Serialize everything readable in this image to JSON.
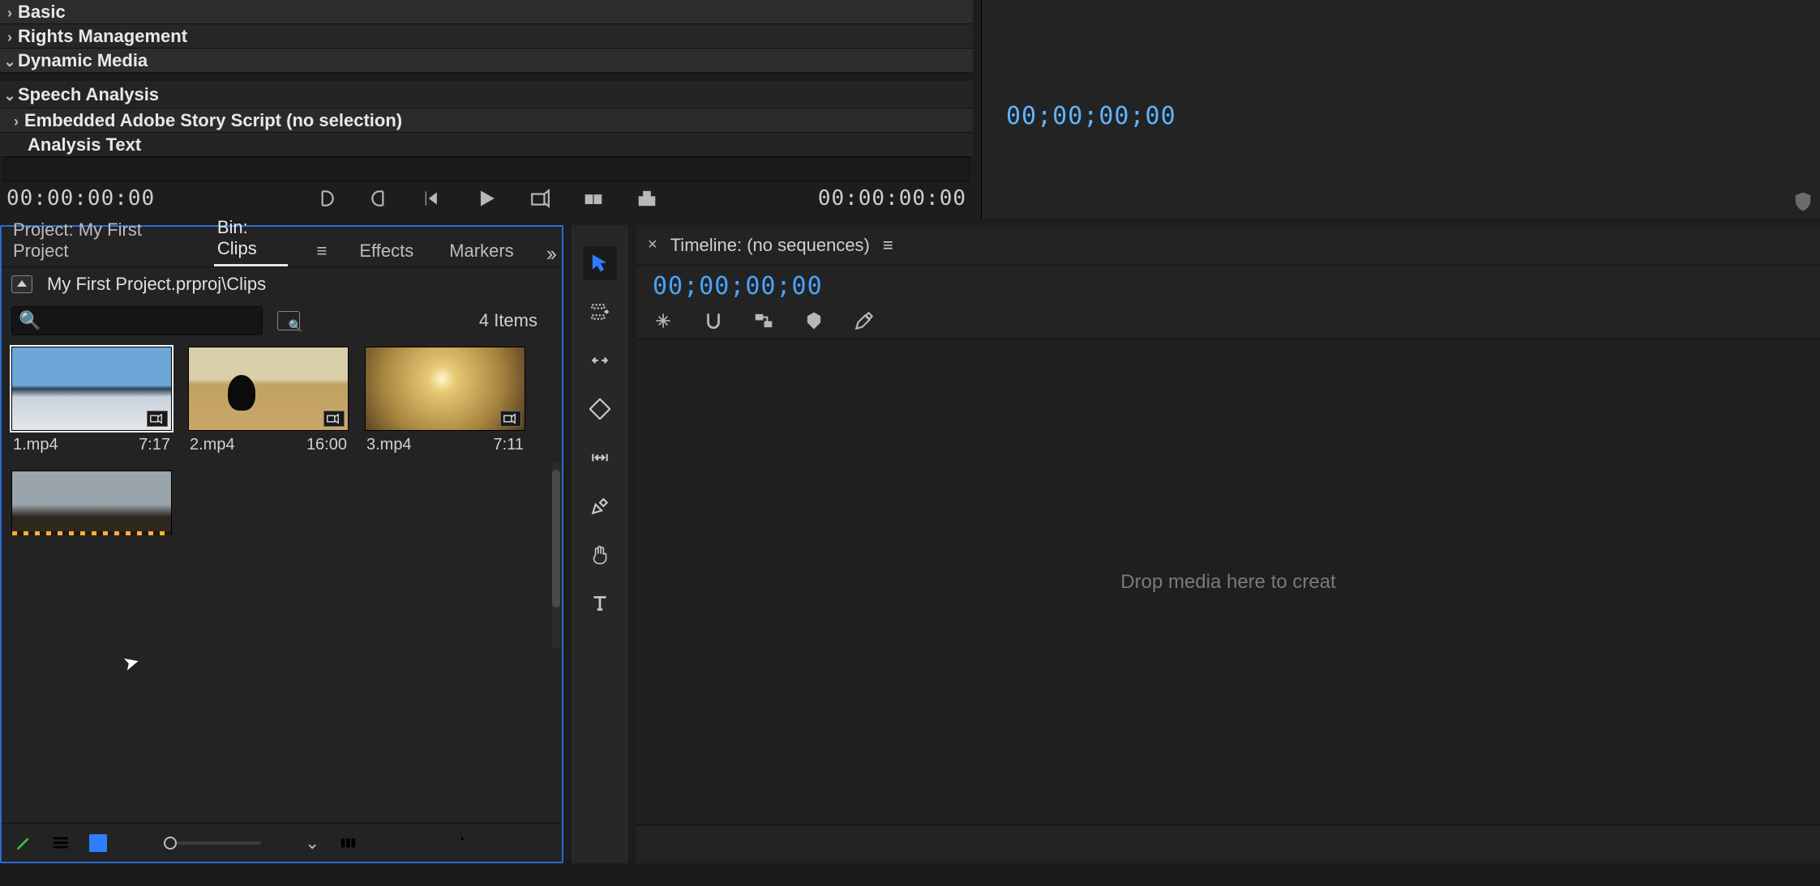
{
  "meta": {
    "basic": "Basic",
    "rights": "Rights Management",
    "dynamic": "Dynamic Media",
    "speech": "Speech Analysis",
    "story": "Embedded Adobe Story Script (no selection)",
    "analysis": "Analysis Text"
  },
  "source": {
    "tc_in": "00:00:00:00",
    "tc_out": "00:00:00:00"
  },
  "program": {
    "tc": "00;00;00;00"
  },
  "project": {
    "tabs": {
      "project": "Project: My First Project",
      "bin": "Bin: Clips",
      "effects": "Effects",
      "markers": "Markers"
    },
    "path": "My First Project.prproj\\Clips",
    "count": "4 Items",
    "clips": [
      {
        "name": "1.mp4",
        "dur": "7:17"
      },
      {
        "name": "2.mp4",
        "dur": "16:00"
      },
      {
        "name": "3.mp4",
        "dur": "7:11"
      },
      {
        "name": "",
        "dur": ""
      }
    ]
  },
  "timeline": {
    "title": "Timeline: (no sequences)",
    "tc": "00;00;00;00",
    "drop": "Drop media here to creat"
  }
}
